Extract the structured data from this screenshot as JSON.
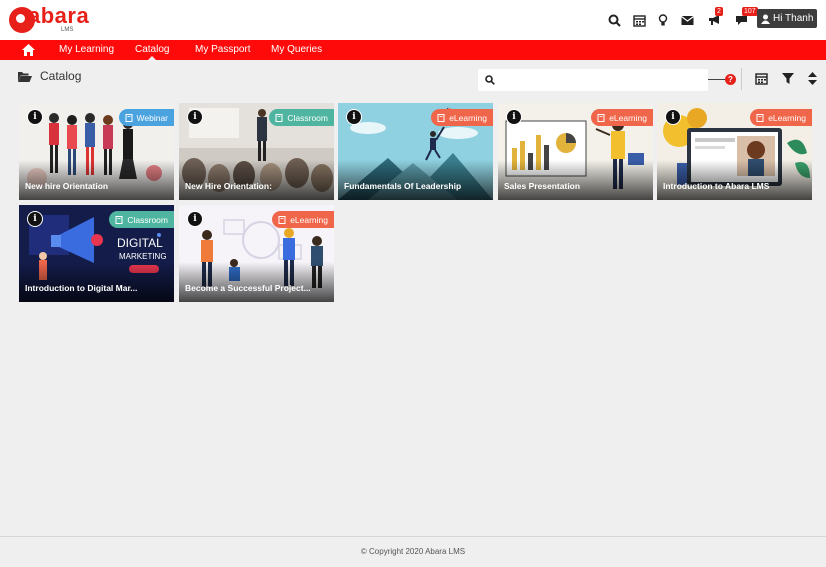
{
  "brand": {
    "name": "abara",
    "sub": "LMS",
    "color": "#e8201a"
  },
  "header": {
    "icons": [
      "search-icon",
      "calendar-icon",
      "lightbulb-icon",
      "mail-icon",
      "megaphone-icon",
      "chat-icon"
    ],
    "announcements_badge": "2",
    "messages_badge": "107",
    "user_label": "Hi Thanh"
  },
  "nav": {
    "items": [
      {
        "label": "My Learning"
      },
      {
        "label": "Catalog",
        "active": true
      },
      {
        "label": "My Passport"
      },
      {
        "label": "My Queries"
      }
    ]
  },
  "page": {
    "title": "Catalog",
    "search": {
      "placeholder": "",
      "value": ""
    }
  },
  "cards": [
    {
      "title": "New hire Orientation",
      "tag": "Webinar",
      "tag_color": "#4aa3df"
    },
    {
      "title": "New Hire Orientation:",
      "tag": "Classroom",
      "tag_color": "#4fb5a0"
    },
    {
      "title": "Fundamentals Of Leadership",
      "tag": "eLearning",
      "tag_color": "#f0664a"
    },
    {
      "title": "Sales Presentation",
      "tag": "eLearning",
      "tag_color": "#f0664a"
    },
    {
      "title": "Introduction to Abara LMS",
      "tag": "eLearning",
      "tag_color": "#f0664a"
    },
    {
      "title": "Introduction to Digital Mar...",
      "tag": "Classroom",
      "tag_color": "#4fb5a0"
    },
    {
      "title": "Become a Successful Project...",
      "tag": "eLearning",
      "tag_color": "#f0664a"
    }
  ],
  "art_text": {
    "digital": "DIGITAL",
    "marketing": "MARKETING"
  },
  "footer": {
    "copyright": "© Copyright 2020 Abara LMS"
  }
}
